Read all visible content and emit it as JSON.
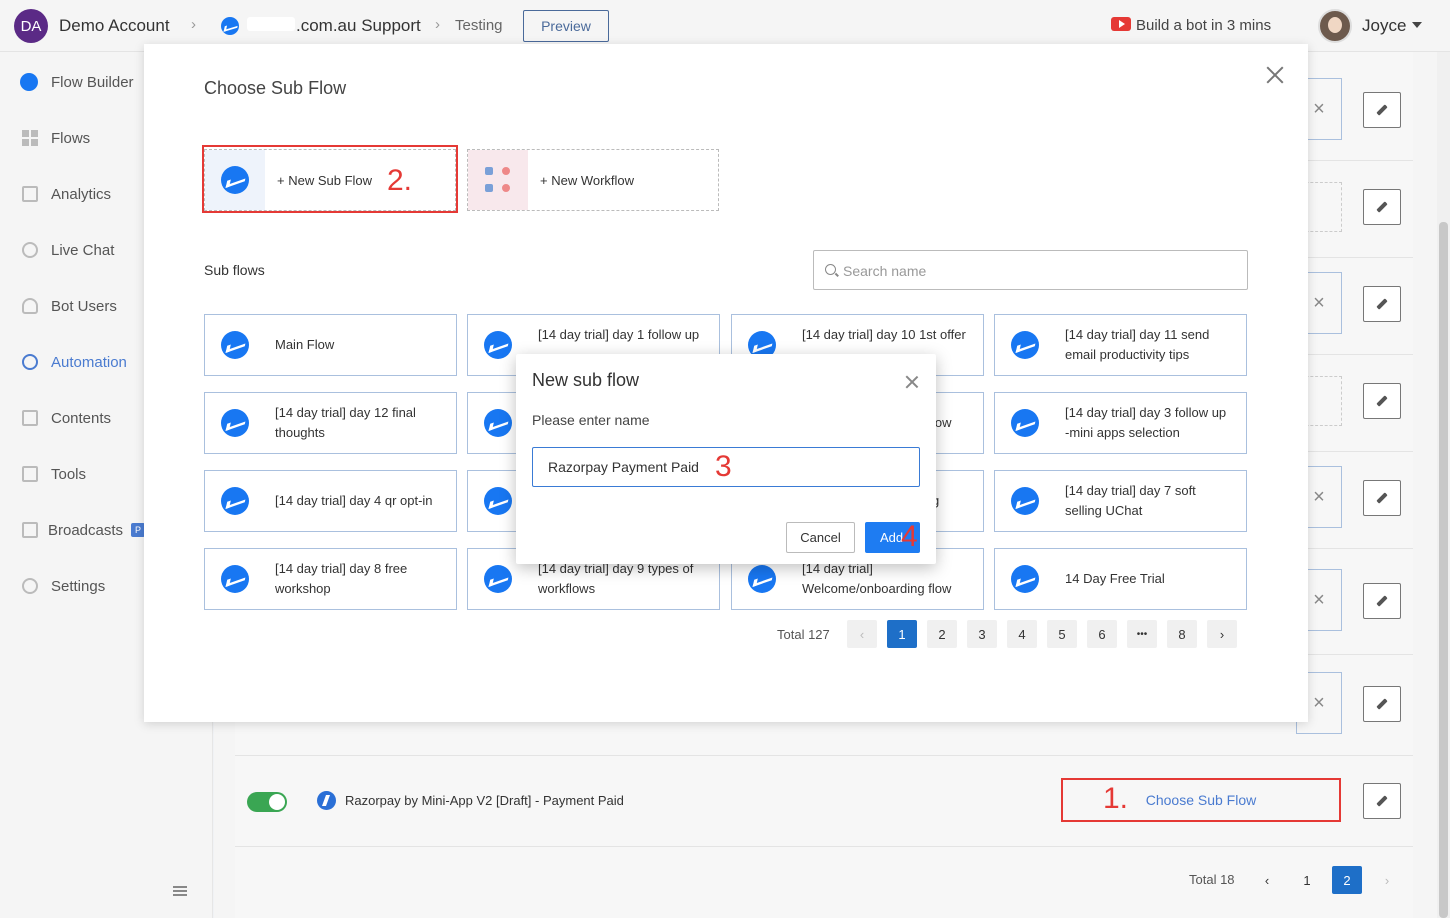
{
  "topbar": {
    "avatar_initials": "DA",
    "account": "Demo Account",
    "page_name": ".com.au Support",
    "crumb_current": "Testing",
    "preview_label": "Preview",
    "build_bot": "Build a bot in 3 mins",
    "user_name": "Joyce"
  },
  "sidebar": {
    "items": [
      {
        "label": "Flow Builder",
        "icon": "messenger-icon"
      },
      {
        "label": "Flows",
        "icon": "grid-icon"
      },
      {
        "label": "Analytics",
        "icon": "chart-icon"
      },
      {
        "label": "Live Chat",
        "icon": "headset-icon"
      },
      {
        "label": "Bot Users",
        "icon": "user-icon"
      },
      {
        "label": "Automation",
        "icon": "automation-icon"
      },
      {
        "label": "Contents",
        "icon": "contents-icon"
      },
      {
        "label": "Tools",
        "icon": "tools-icon"
      },
      {
        "label": "Broadcasts",
        "icon": "megaphone-icon"
      },
      {
        "label": "Settings",
        "icon": "gear-icon"
      }
    ],
    "pro_badge": "P"
  },
  "background": {
    "flow_name": "Razorpay by Mini-App V2 [Draft] - Payment Paid",
    "choose_sub_flow": "Choose Sub Flow",
    "total": "Total 18",
    "pages": [
      "1",
      "2"
    ],
    "active_page": "2"
  },
  "panel": {
    "title": "Choose Sub Flow",
    "new_sub_flow": "+ New Sub Flow",
    "new_workflow": "+ New Workflow",
    "sub_flows_label": "Sub flows",
    "search_placeholder": "Search name",
    "cards": [
      "Main Flow",
      "[14 day trial] day 1 follow up",
      "[14 day trial] day 10 1st offer",
      "[14 day trial] day 11 send email productivity tips",
      "[14 day trial] day 12 final thoughts",
      "",
      "low",
      "[14 day trial] day 3 follow up -mini apps selection",
      "[14 day trial] day 4 qr opt-in",
      "",
      "g",
      "[14 day trial] day 7 soft selling UChat",
      "[14 day trial] day 8 free workshop",
      "[14 day trial] day 9 types of workflows",
      "[14 day trial] Welcome/onboarding flow",
      "14 Day Free Trial"
    ],
    "total": "Total 127",
    "pages": [
      "1",
      "2",
      "3",
      "4",
      "5",
      "6",
      "•••",
      "8"
    ],
    "active_page": "1"
  },
  "modal": {
    "title": "New sub flow",
    "prompt": "Please enter name",
    "input_value": "Razorpay Payment Paid",
    "cancel_label": "Cancel",
    "add_label": "Add"
  },
  "annotations": {
    "a1": "1.",
    "a2": "2.",
    "a3": "3",
    "a4": "4"
  },
  "colors": {
    "accent": "#1e7cf2",
    "annotation": "#e53935",
    "messenger": "#1877f2",
    "toggle_on": "#3aa653"
  }
}
